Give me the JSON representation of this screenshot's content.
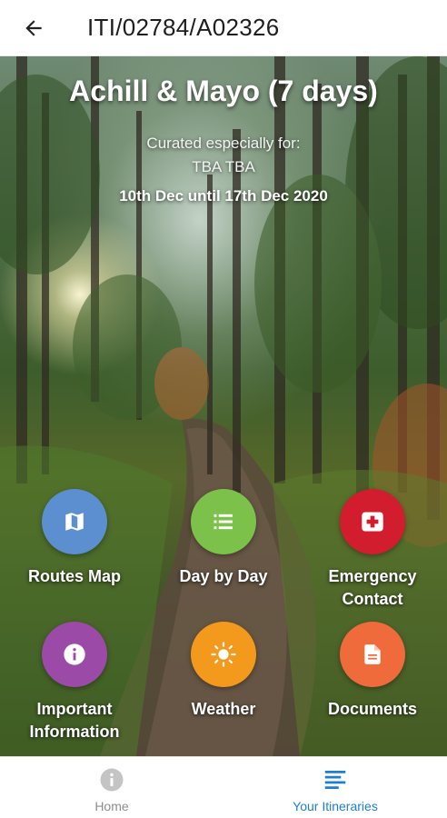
{
  "appbar": {
    "title": "ITI/02784/A02326",
    "back_icon": "arrow-left-icon"
  },
  "hero": {
    "title": "Achill & Mayo (7 days)",
    "curated_label": "Curated especially for:",
    "guest_name": "TBA TBA",
    "dates": "10th Dec until 17th Dec 2020"
  },
  "tiles": [
    {
      "label": "Routes Map",
      "icon": "map-icon",
      "color": "#5b8fd0"
    },
    {
      "label": "Day by Day",
      "icon": "list-icon",
      "color": "#7cc24a"
    },
    {
      "label": "Emergency Contact",
      "icon": "first-aid-icon",
      "color": "#d11d2e"
    },
    {
      "label": "Important Information",
      "icon": "info-icon",
      "color": "#9b4aa8"
    },
    {
      "label": "Weather",
      "icon": "sun-icon",
      "color": "#f39a1c"
    },
    {
      "label": "Documents",
      "icon": "document-icon",
      "color": "#ef6b3b"
    }
  ],
  "bottom_nav": {
    "home": {
      "label": "Home",
      "icon": "info-icon",
      "color": "#8d8d8d"
    },
    "itineraries": {
      "label": "Your Itineraries",
      "icon": "list-icon",
      "color": "#1e7fd2"
    }
  }
}
